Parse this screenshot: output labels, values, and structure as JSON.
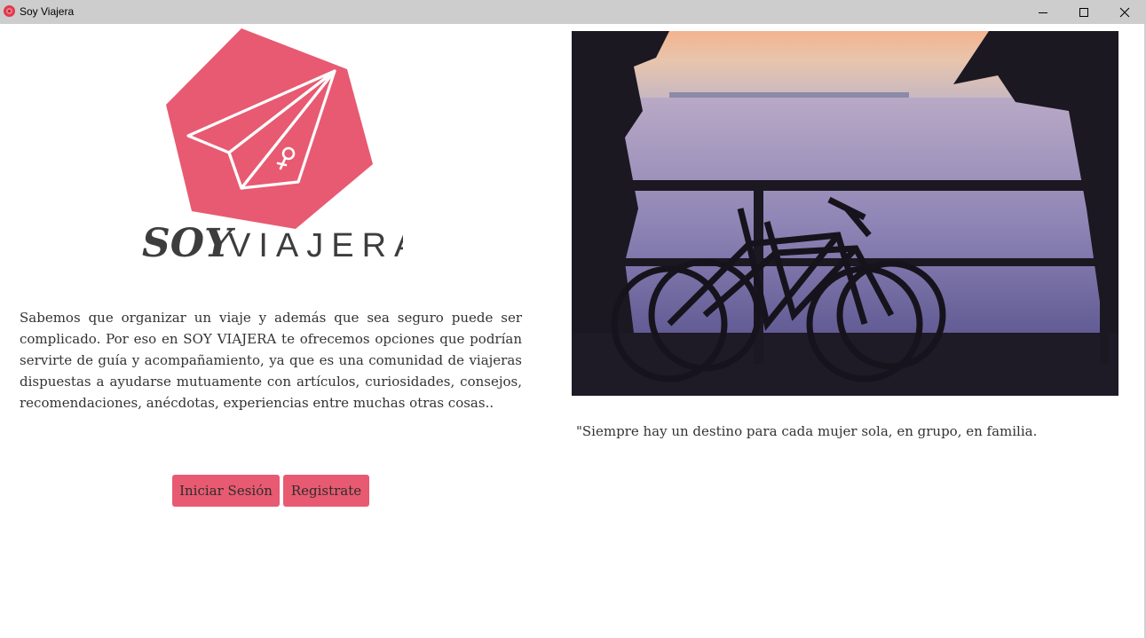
{
  "window": {
    "title": "Soy Viajera"
  },
  "logo": {
    "word_soy": "SOY",
    "word_viajera": "VIAJERA"
  },
  "description": "Sabemos que organizar un viaje y además que sea seguro puede ser complicado. Por eso en SOY VIAJERA te ofrecemos opciones que podrían servirte de guía y acompañamiento, ya que es una comunidad de viajeras dispuestas a ayudarse mutuamente con artículos, curiosidades, consejos, recomendaciones, anécdotas, experiencias entre muchas otras cosas..",
  "buttons": {
    "login": "Iniciar Sesión",
    "register": "Registrate"
  },
  "quote": "\"Siempre hay un destino para cada mujer sola, en grupo, en familia.",
  "colors": {
    "brand_pink": "#e85a71",
    "titlebar": "#cdcdcd"
  },
  "icons": {
    "app": "rose-icon",
    "minimize": "minimize-icon",
    "maximize": "maximize-icon",
    "close": "close-icon"
  }
}
